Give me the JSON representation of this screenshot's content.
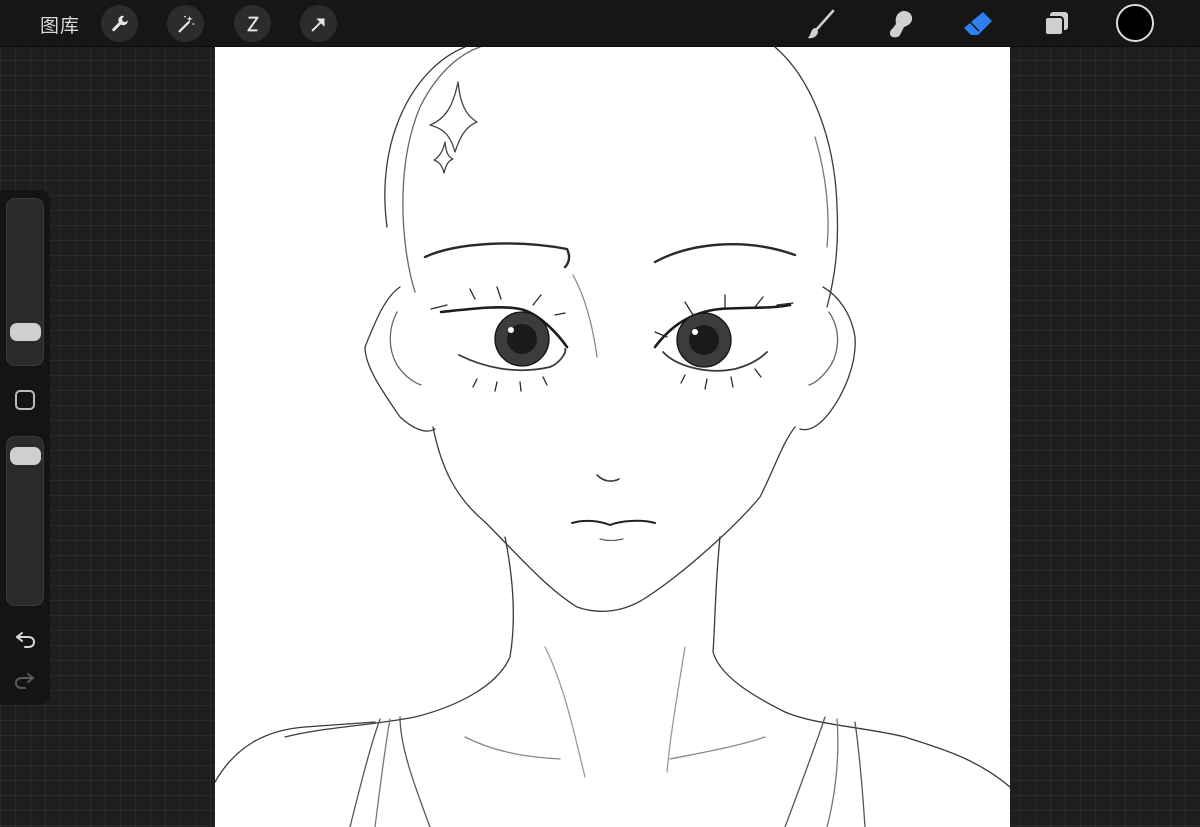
{
  "topbar": {
    "gallery_label": "图库",
    "left_tools": [
      "wrench-icon",
      "magic-wand-icon",
      "selection-icon",
      "transform-arrow-icon"
    ],
    "right_tools": [
      "brush-icon",
      "smudge-icon",
      "eraser-icon",
      "layers-icon"
    ],
    "active_tool": "eraser",
    "active_color": "#2f7ff0",
    "current_color": "#000000"
  },
  "sidebar": {
    "brush_size_level": 0.15,
    "opacity_level": 0.95,
    "modify_button": "square-icon",
    "undo": "undo-arrow-icon",
    "redo": "redo-arrow-icon"
  },
  "canvas": {
    "background": "#ffffff",
    "content": "pencil-sketch-portrait"
  }
}
